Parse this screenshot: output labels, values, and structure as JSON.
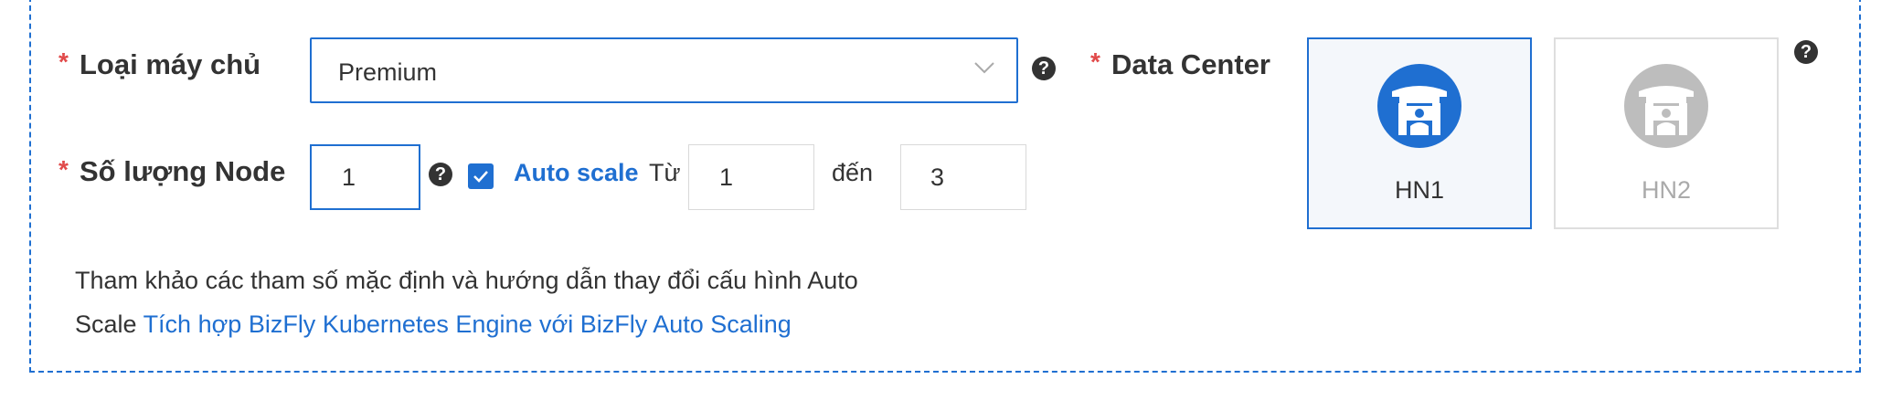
{
  "server_type": {
    "required_mark": "*",
    "label": "Loại máy chủ",
    "selected_value": "Premium"
  },
  "node_count": {
    "required_mark": "*",
    "label": "Số lượng Node",
    "value": "1"
  },
  "auto_scale": {
    "checked": true,
    "label": "Auto scale",
    "from_label": "Từ",
    "from_value": "1",
    "to_label": "đến",
    "to_value": "3"
  },
  "data_center": {
    "required_mark": "*",
    "label": "Data Center",
    "options": [
      {
        "name": "HN1",
        "selected": true
      },
      {
        "name": "HN2",
        "selected": false
      }
    ]
  },
  "help_glyph": "?",
  "note": {
    "text_line1": "Tham khảo các tham số mặc định và hướng dẫn thay đổi cấu hình Auto",
    "text_line2_prefix": "Scale ",
    "link_text": "Tích hợp BizFly Kubernetes Engine với BizFly Auto Scaling"
  },
  "colors": {
    "accent": "#1f6fd1",
    "required": "#e14a4a",
    "disabled": "#bdbdbd"
  }
}
